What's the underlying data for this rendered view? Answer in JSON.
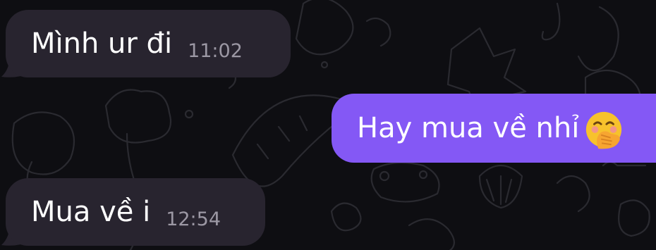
{
  "chat": {
    "messages": [
      {
        "direction": "incoming",
        "text": "Mình ur đi",
        "time": "11:02"
      },
      {
        "direction": "outgoing",
        "text": "Hay mua về nhỉ",
        "emoji": "face-with-hand-over-mouth"
      },
      {
        "direction": "incoming",
        "text": "Mua về i",
        "time": "12:54"
      }
    ]
  },
  "colors": {
    "background": "#0e0e12",
    "incoming_bubble": "#28242f",
    "outgoing_bubble": "#8458f5",
    "timestamp": "#9c98a4",
    "doodle": "#2a2a30"
  }
}
